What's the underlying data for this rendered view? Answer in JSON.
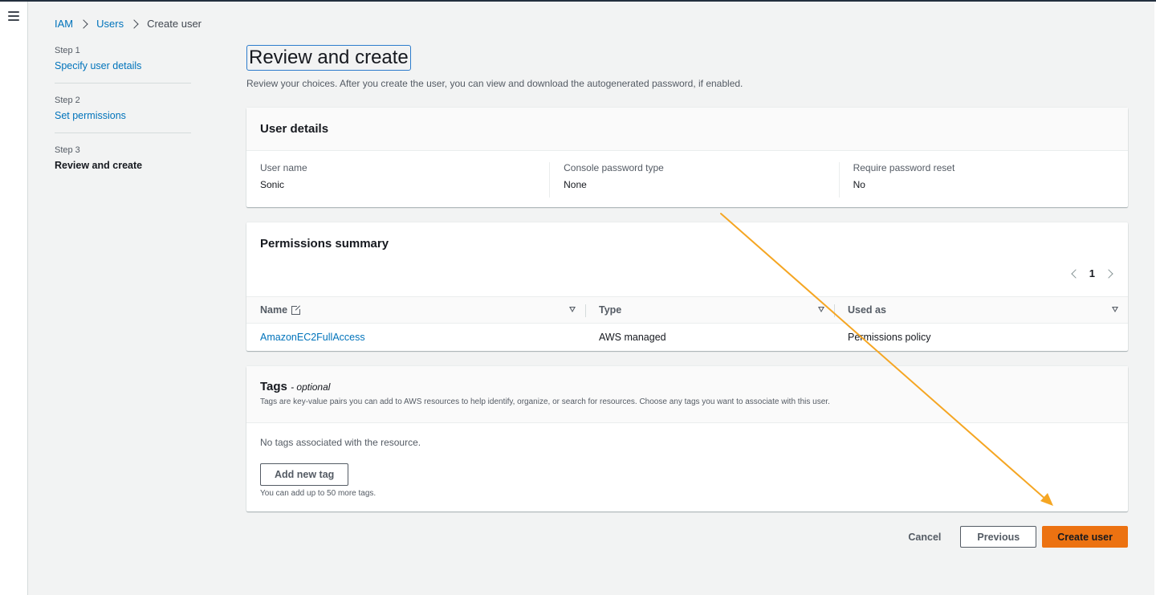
{
  "breadcrumb": {
    "items": [
      "IAM",
      "Users"
    ],
    "current": "Create user"
  },
  "steps": [
    {
      "num": "Step 1",
      "label": "Specify user details"
    },
    {
      "num": "Step 2",
      "label": "Set permissions"
    },
    {
      "num": "Step 3",
      "label": "Review and create"
    }
  ],
  "page": {
    "title": "Review and create",
    "description": "Review your choices. After you create the user, you can view and download the autogenerated password, if enabled."
  },
  "user_details": {
    "title": "User details",
    "fields": [
      {
        "label": "User name",
        "value": "Sonic"
      },
      {
        "label": "Console password type",
        "value": "None"
      },
      {
        "label": "Require password reset",
        "value": "No"
      }
    ]
  },
  "permissions": {
    "title": "Permissions summary",
    "page_number": "1",
    "columns": [
      "Name",
      "Type",
      "Used as"
    ],
    "rows": [
      {
        "name": "AmazonEC2FullAccess",
        "type": "AWS managed",
        "used_as": "Permissions policy"
      }
    ]
  },
  "tags": {
    "title": "Tags",
    "optional": "- optional",
    "description": "Tags are key-value pairs you can add to AWS resources to help identify, organize, or search for resources. Choose any tags you want to associate with this user.",
    "empty_text": "No tags associated with the resource.",
    "add_button": "Add new tag",
    "hint": "You can add up to 50 more tags."
  },
  "actions": {
    "cancel": "Cancel",
    "previous": "Previous",
    "create": "Create user"
  },
  "colors": {
    "link": "#0073bb",
    "primary_button": "#ec7211",
    "annotation_arrow": "#f5a623"
  },
  "icons": [
    "menu-icon",
    "chevron-right-icon",
    "external-link-icon",
    "sort-caret-icon",
    "chevron-left-icon"
  ]
}
